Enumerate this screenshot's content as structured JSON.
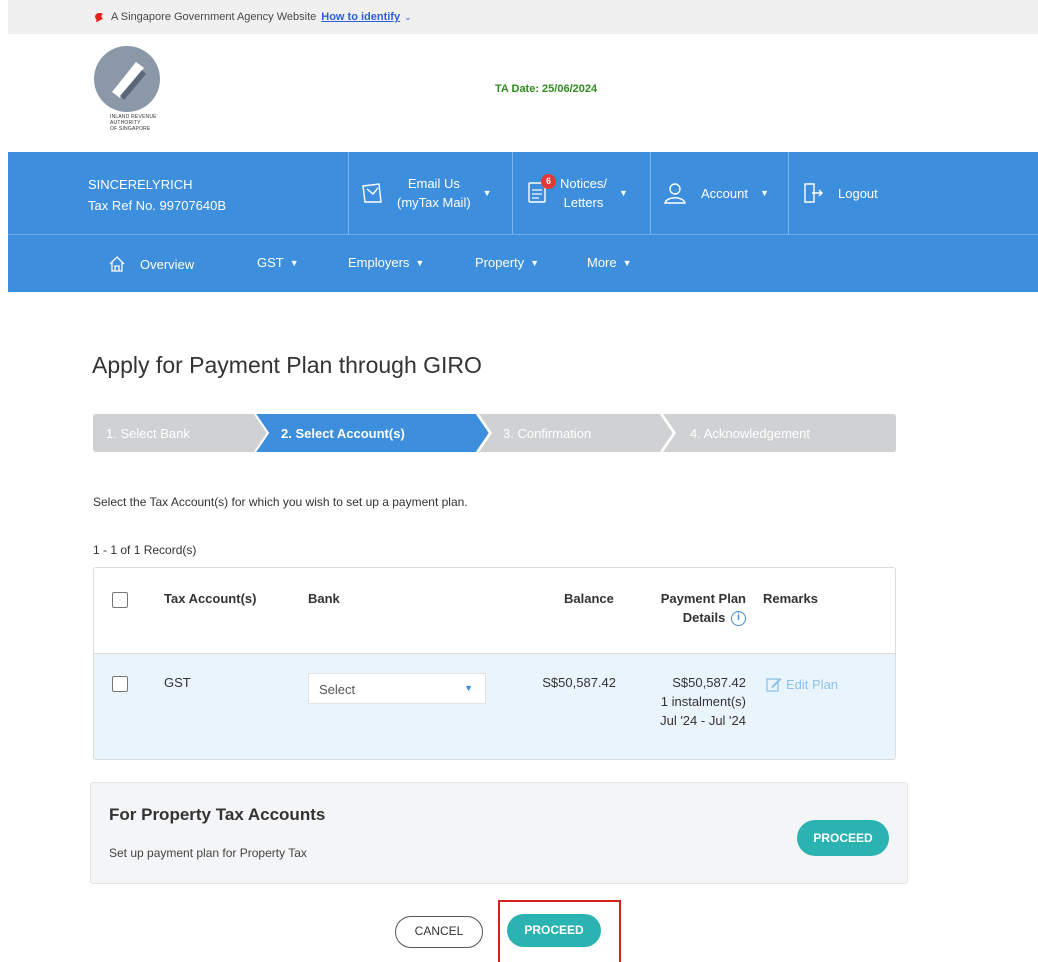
{
  "gov_banner": {
    "text": "A Singapore Government Agency Website",
    "link": "How to identify"
  },
  "header": {
    "logo_text_lines": [
      "INLAND REVENUE",
      "AUTHORITY",
      "OF SINGAPORE"
    ],
    "ta_date": "TA Date: 25/06/2024"
  },
  "user": {
    "name": "SINCERELYRICH",
    "tax_ref": "Tax Ref No. 99707640B"
  },
  "topnav": {
    "email_line1": "Email Us",
    "email_line2": "(myTax Mail)",
    "notices_line1": "Notices/",
    "notices_line2": "Letters",
    "notices_count": "6",
    "account": "Account",
    "logout": "Logout"
  },
  "subnav": {
    "overview": "Overview",
    "gst": "GST",
    "employers": "Employers",
    "property": "Property",
    "more": "More"
  },
  "page_title": "Apply for Payment Plan through GIRO",
  "stepper": {
    "steps": [
      "1. Select Bank",
      "2. Select Account(s)",
      "3. Confirmation",
      "4. Acknowledgement"
    ],
    "active_index": 1,
    "active_color": "#3d8edc",
    "inactive_color": "#cfd1d3"
  },
  "instruction": "Select the Tax Account(s) for which you wish to set up a payment plan.",
  "records": "1 - 1 of 1 Record(s)",
  "table": {
    "headers": {
      "tax_account": "Tax Account(s)",
      "bank": "Bank",
      "balance": "Balance",
      "plan_line1": "Payment Plan",
      "plan_line2": "Details",
      "remarks": "Remarks"
    },
    "rows": [
      {
        "tax_account": "GST",
        "bank_placeholder": "Select",
        "balance": "S$50,587.42",
        "plan_amount": "S$50,587.42",
        "plan_instalments": "1 instalment(s)",
        "plan_period": "Jul '24 - Jul '24",
        "remarks_action": "Edit Plan"
      }
    ]
  },
  "property_box": {
    "title": "For Property Tax Accounts",
    "subtitle": "Set up payment plan for Property Tax",
    "button": "PROCEED"
  },
  "actions": {
    "cancel": "CANCEL",
    "proceed": "PROCEED"
  },
  "colors": {
    "brand_blue": "#3d8edc",
    "teal": "#2ab3b1",
    "highlight": "#d61f1f",
    "ta_date_green": "#2e8b1e"
  }
}
